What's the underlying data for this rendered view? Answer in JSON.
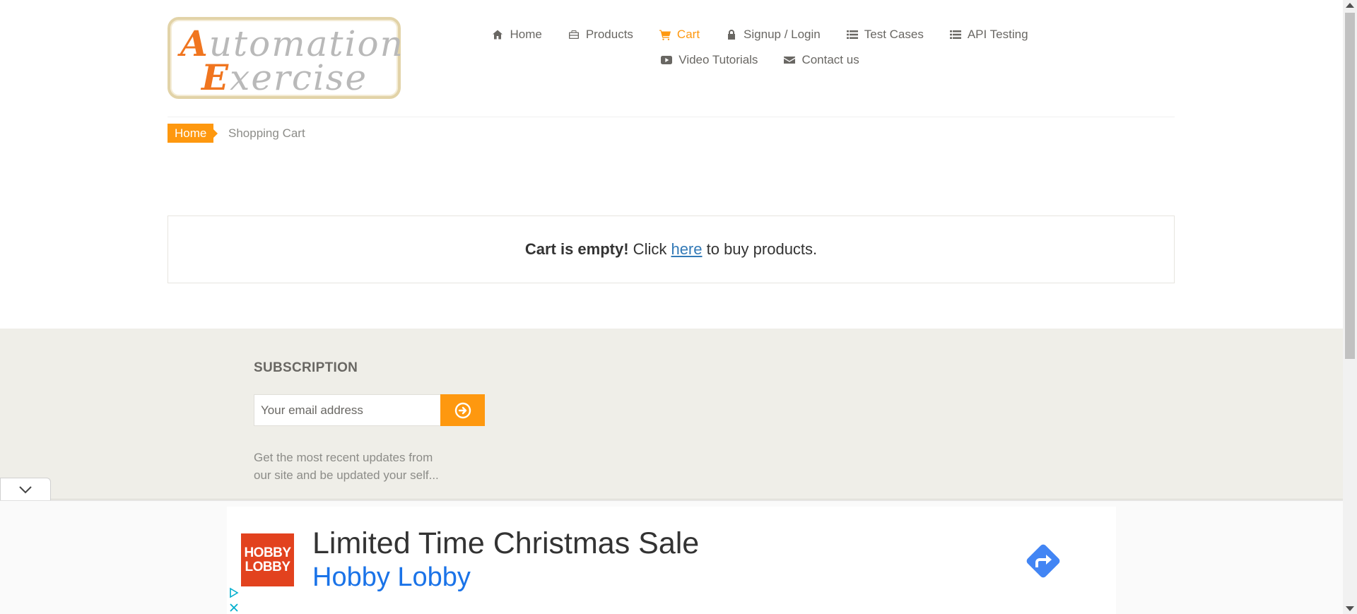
{
  "logo": {
    "line1_cap": "A",
    "line1_rest": "utomation",
    "line2_cap": "E",
    "line2_rest": "xercise"
  },
  "nav": {
    "row1": [
      {
        "label": "Home",
        "icon": "home-icon",
        "active": false
      },
      {
        "label": "Products",
        "icon": "briefcase-icon",
        "active": false
      },
      {
        "label": "Cart",
        "icon": "shopping-cart-icon",
        "active": true
      },
      {
        "label": "Signup / Login",
        "icon": "lock-icon",
        "active": false
      },
      {
        "label": "Test Cases",
        "icon": "list-icon",
        "active": false
      },
      {
        "label": "API Testing",
        "icon": "list-icon",
        "active": false
      }
    ],
    "row2": [
      {
        "label": "Video Tutorials",
        "icon": "youtube-play-icon",
        "active": false
      },
      {
        "label": "Contact us",
        "icon": "envelope-icon",
        "active": false
      }
    ]
  },
  "breadcrumb": {
    "home": "Home",
    "current": "Shopping Cart"
  },
  "cart": {
    "empty_bold": "Cart is empty!",
    "click_text": " Click ",
    "link_text": "here",
    "after_text": " to buy products."
  },
  "footer": {
    "subscription_title": "SUBSCRIPTION",
    "email_placeholder": "Your email address",
    "description_line1": "Get the most recent updates from",
    "description_line2": "our site and be updated your self..."
  },
  "ad": {
    "logo_line1": "HOBBY",
    "logo_line2": "LOBBY",
    "headline": "Limited Time Christmas Sale",
    "brand": "Hobby Lobby"
  },
  "colors": {
    "accent": "#fe980f",
    "link": "#337ab7",
    "footer_bg": "#efeee8",
    "ad_brand": "#1a73e8",
    "ad_logo_bg": "#e2421e"
  }
}
